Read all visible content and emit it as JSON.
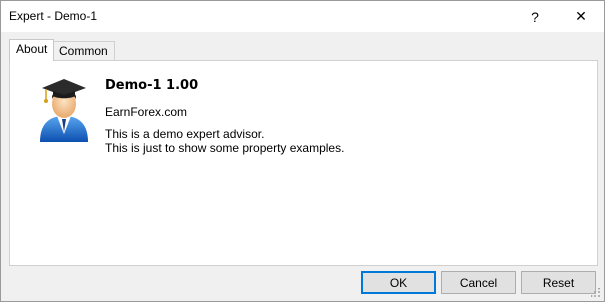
{
  "window": {
    "title": "Expert - Demo-1",
    "help_glyph": "?",
    "close_glyph": "✕"
  },
  "tabs": [
    {
      "label": "About"
    },
    {
      "label": "Common"
    }
  ],
  "about": {
    "name": "Demo-1 1.00",
    "copyright": "EarnForex.com",
    "description_lines": [
      "This is a demo expert advisor.",
      "This is just to show some property examples."
    ],
    "icon": "expert-advisor-graduate-icon"
  },
  "buttons": {
    "ok": "OK",
    "cancel": "Cancel",
    "reset": "Reset"
  },
  "colors": {
    "accent": "#0078d7",
    "panel_bg": "#ffffff",
    "dialog_bg": "#f0f0f0",
    "icon_blue": "#1e6fd0"
  }
}
